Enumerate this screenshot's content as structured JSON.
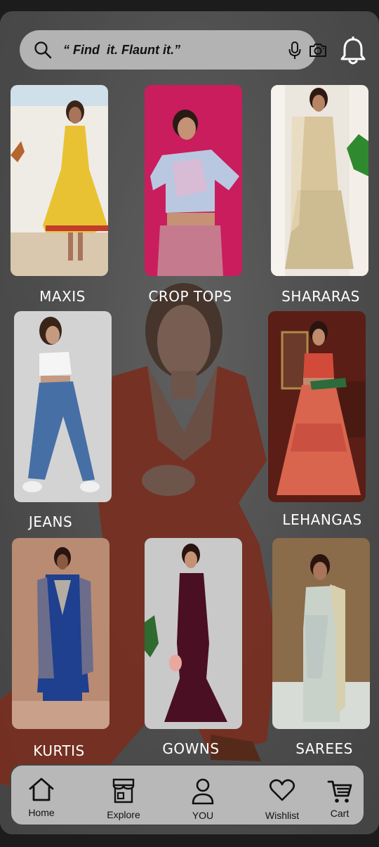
{
  "search": {
    "placeholder": "“ Find  it. Flaunt it.”",
    "value": ""
  },
  "icons": {
    "search": "search-icon",
    "mic": "mic-icon",
    "camera": "camera-icon",
    "notifications": "bell-icon"
  },
  "categories": [
    {
      "label": "MAXIS",
      "colors": {
        "bg": "#d9d3c6",
        "outfit": "#e9c334"
      }
    },
    {
      "label": "CROP TOPS",
      "colors": {
        "bg": "#c91d5e",
        "outfit": "#b9c8e0"
      }
    },
    {
      "label": "SHARARAS",
      "colors": {
        "bg": "#e8e2d8",
        "outfit": "#cdbb92"
      }
    },
    {
      "label": "JEANS",
      "colors": {
        "bg": "#cfcfcf",
        "outfit": "#4670a5"
      }
    },
    {
      "label": "LEHANGAS",
      "colors": {
        "bg": "#5a1e16",
        "outfit": "#d9654e"
      }
    },
    {
      "label": "KURTIS",
      "colors": {
        "bg": "#b88a73",
        "outfit": "#1f3f8f"
      }
    },
    {
      "label": "GOWNS",
      "colors": {
        "bg": "#c9c9c9",
        "outfit": "#4a0f22"
      }
    },
    {
      "label": "SAREES",
      "colors": {
        "bg": "#8a6b4a",
        "outfit": "#c9d2c8"
      }
    }
  ],
  "nav": [
    {
      "label": "Home",
      "icon": "home-icon"
    },
    {
      "label": "Explore",
      "icon": "store-icon"
    },
    {
      "label": "YOU",
      "icon": "user-icon"
    },
    {
      "label": "Wishlist",
      "icon": "heart-icon"
    },
    {
      "label": "Cart",
      "icon": "cart-icon"
    }
  ]
}
